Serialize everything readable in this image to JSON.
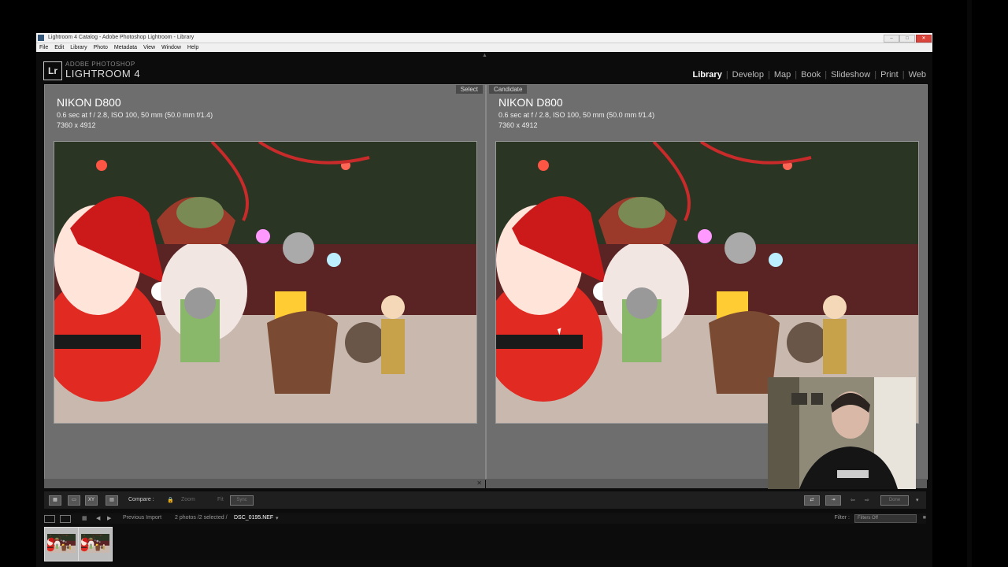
{
  "window": {
    "title": "Lightroom 4 Catalog - Adobe Photoshop Lightroom - Library",
    "buttons": [
      "–",
      "□",
      "✕"
    ]
  },
  "menu": [
    "File",
    "Edit",
    "Library",
    "Photo",
    "Metadata",
    "View",
    "Window",
    "Help"
  ],
  "branding": {
    "badge": "Lr",
    "adobe": "ADOBE PHOTOSHOP",
    "product": "LIGHTROOM 4"
  },
  "modules": {
    "items": [
      "Library",
      "Develop",
      "Map",
      "Book",
      "Slideshow",
      "Print",
      "Web"
    ],
    "active": "Library",
    "separator": "|"
  },
  "panes": {
    "select": {
      "badge": "Select",
      "camera": "NIKON D800",
      "exif": "0.6 sec at f / 2.8, ISO 100, 50 mm (50.0 mm f/1.4)",
      "dimensions": "7360 x 4912"
    },
    "candidate": {
      "badge": "Candidate",
      "camera": "NIKON D800",
      "exif": "0.6 sec at f / 2.8, ISO 100, 50 mm (50.0 mm f/1.4)",
      "dimensions": "7360 x 4912"
    }
  },
  "toolbar": {
    "compare_label": "Compare :",
    "zoom_label": "Zoom",
    "zoom_value": "Fit",
    "sync_button": "Sync",
    "done_button": "Done",
    "view_buttons": [
      "grid",
      "loupe",
      "XY",
      "survey"
    ]
  },
  "filmstrip": {
    "source": "Previous Import",
    "count": "2 photos /2 selected /",
    "filename": "DSC_0195.NEF",
    "filter_label": "Filter :",
    "filter_value": "Filters Off"
  },
  "colors": {
    "pane_bg": "#6e6e6e",
    "app_bg": "#0c0c0c",
    "active_module": "#ffffff"
  }
}
